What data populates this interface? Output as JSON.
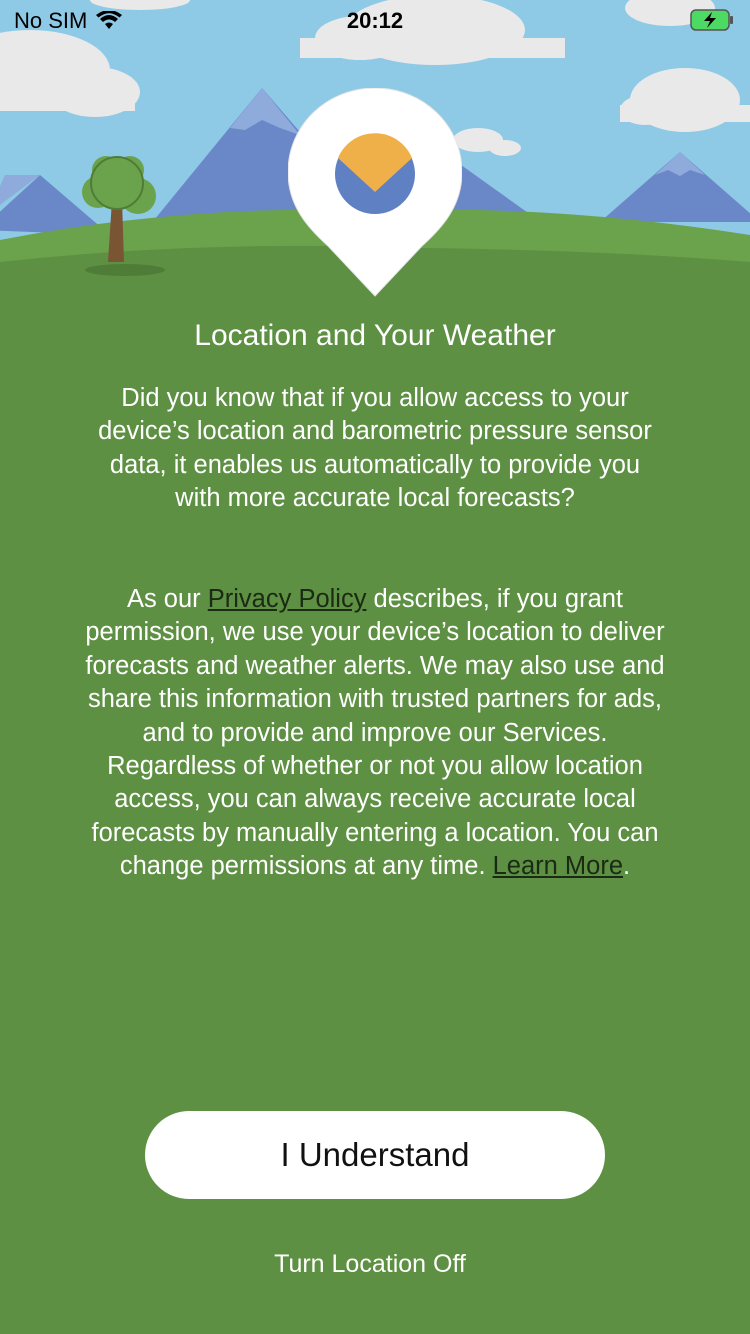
{
  "status_bar": {
    "carrier": "No SIM",
    "time": "20:12",
    "wifi_icon": "wifi-icon",
    "battery_icon": "battery-charging-icon"
  },
  "hero": {
    "illustration": "mountains-and-tree-landscape",
    "pin_icon": "location-pin-weather-logo-icon",
    "colors": {
      "sky": "#8ec9e6",
      "mountain": "#6a88c8",
      "mountain_light": "#8fabdc",
      "grass": "#5d9042",
      "hill": "#6ba24c",
      "cloud": "#e9e9ea",
      "sun": "#efb04a"
    }
  },
  "content": {
    "title": "Location and Your Weather",
    "paragraph1": "Did you know that if you allow access to your device’s location and barometric pressure sensor data, it enables us automatically to provide you with more accurate local forecasts?",
    "paragraph2": {
      "before_link": "As our ",
      "privacy_link": "Privacy Policy",
      "after_link": " describes, if you grant permission, we use your device’s location to deliver forecasts and weather alerts. We may also use and share this information with trusted partners for ads, and to provide and improve our Services. Regardless of whether or not you allow location access, you can always receive accurate local forecasts by manually entering a location. You can change permissions at any time. ",
      "learn_more_link": "Learn More",
      "end": "."
    }
  },
  "actions": {
    "understand_label": "I Understand",
    "turn_off_label": "Turn Location Off"
  },
  "colors": {
    "background": "#5d9042",
    "button_bg": "#ffffff",
    "link": "#1b2a14"
  }
}
